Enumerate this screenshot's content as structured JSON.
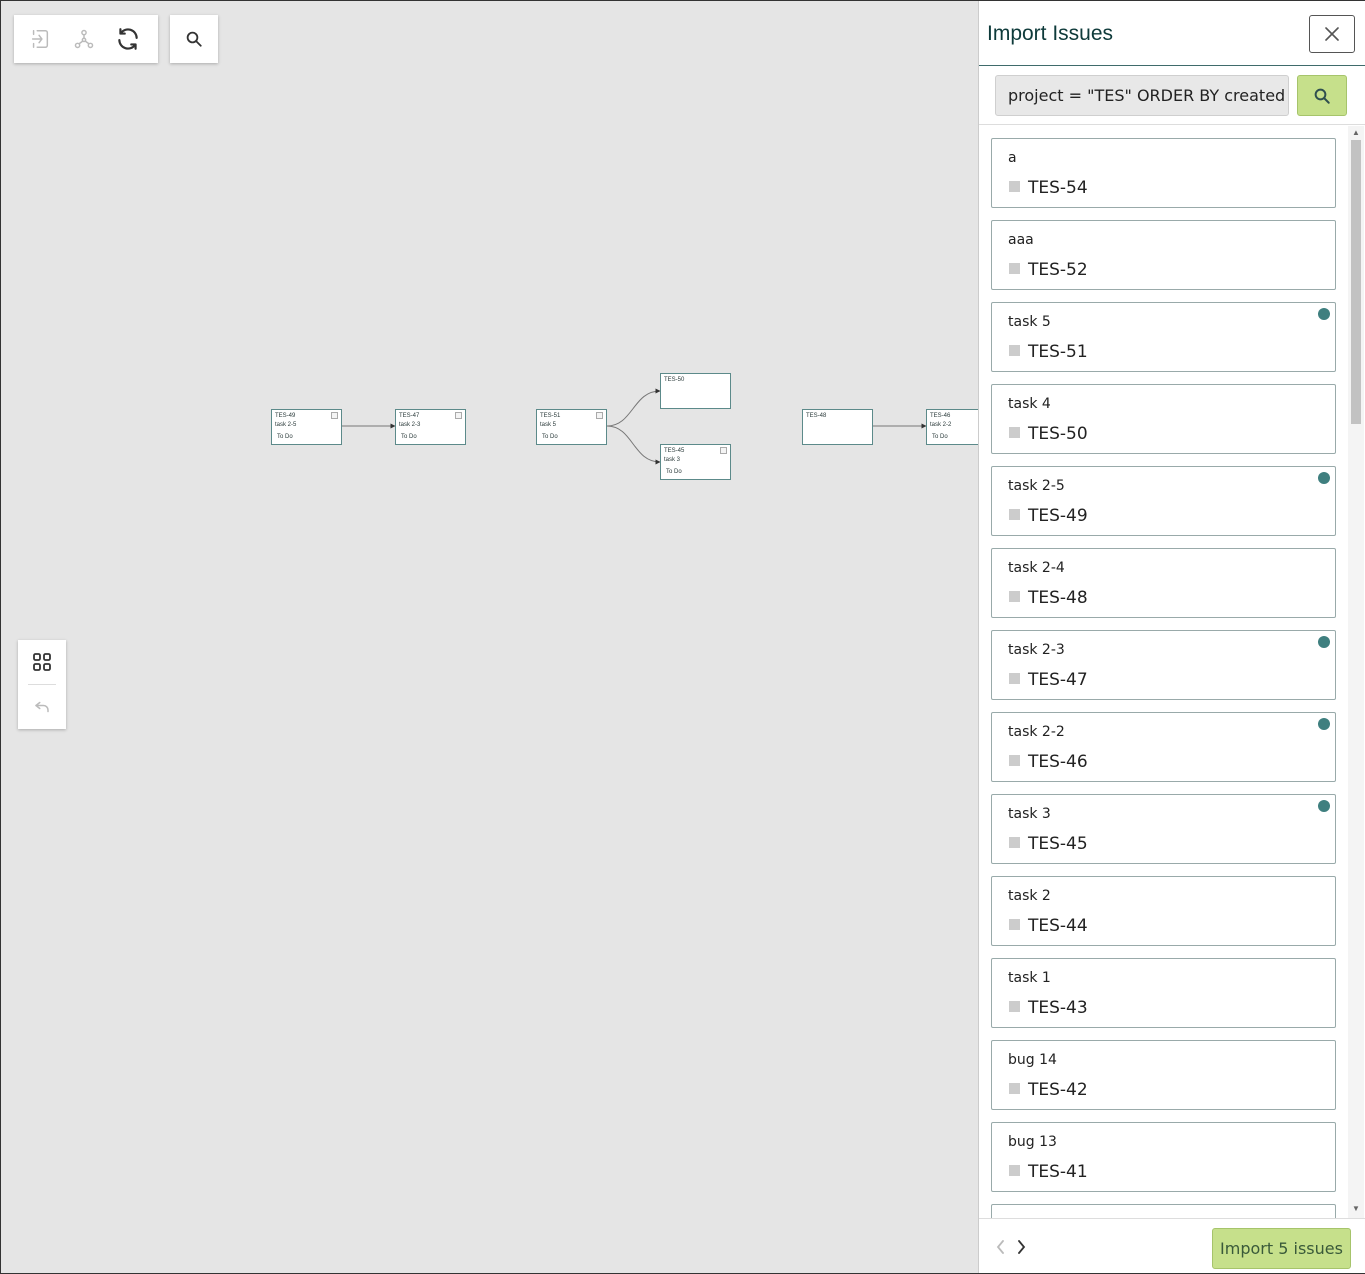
{
  "toolbar": {
    "icons": [
      "import-icon",
      "graph-icon",
      "refresh-icon"
    ],
    "search_icon": "search-icon"
  },
  "side_tools": {
    "icons": [
      "grid-icon",
      "undo-icon"
    ]
  },
  "graph": {
    "nodes": [
      {
        "key": "TES-49",
        "summary": "task 2-5",
        "status": "To Do"
      },
      {
        "key": "TES-47",
        "summary": "task 2-3",
        "status": "To Do"
      },
      {
        "key": "TES-51",
        "summary": "task 5",
        "status": "To Do"
      },
      {
        "key": "TES-50",
        "summary": "",
        "status": ""
      },
      {
        "key": "TES-45",
        "summary": "task 3",
        "status": "To Do"
      },
      {
        "key": "TES-48",
        "summary": "",
        "status": ""
      },
      {
        "key": "TES-46",
        "summary": "task 2-2",
        "status": "To Do"
      }
    ]
  },
  "panel": {
    "title": "Import Issues",
    "query": "project = \"TES\" ORDER BY created DESC",
    "issues": [
      {
        "summary": "a",
        "key": "TES-54",
        "marked": false
      },
      {
        "summary": "aaa",
        "key": "TES-52",
        "marked": false
      },
      {
        "summary": "task 5",
        "key": "TES-51",
        "marked": true
      },
      {
        "summary": "task 4",
        "key": "TES-50",
        "marked": false
      },
      {
        "summary": "task 2-5",
        "key": "TES-49",
        "marked": true
      },
      {
        "summary": "task 2-4",
        "key": "TES-48",
        "marked": false
      },
      {
        "summary": "task 2-3",
        "key": "TES-47",
        "marked": true
      },
      {
        "summary": "task 2-2",
        "key": "TES-46",
        "marked": true
      },
      {
        "summary": "task 3",
        "key": "TES-45",
        "marked": true
      },
      {
        "summary": "task 2",
        "key": "TES-44",
        "marked": false
      },
      {
        "summary": "task 1",
        "key": "TES-43",
        "marked": false
      },
      {
        "summary": "bug 14",
        "key": "TES-42",
        "marked": false
      },
      {
        "summary": "bug 13",
        "key": "TES-41",
        "marked": false
      },
      {
        "summary": "",
        "key": "",
        "marked": false
      }
    ],
    "import_label": "Import 5 issues"
  },
  "colors": {
    "accent": "#c6e08b",
    "marker": "#3f7f7f",
    "title": "#0e3a3a",
    "canvas": "#e5e5e5"
  }
}
